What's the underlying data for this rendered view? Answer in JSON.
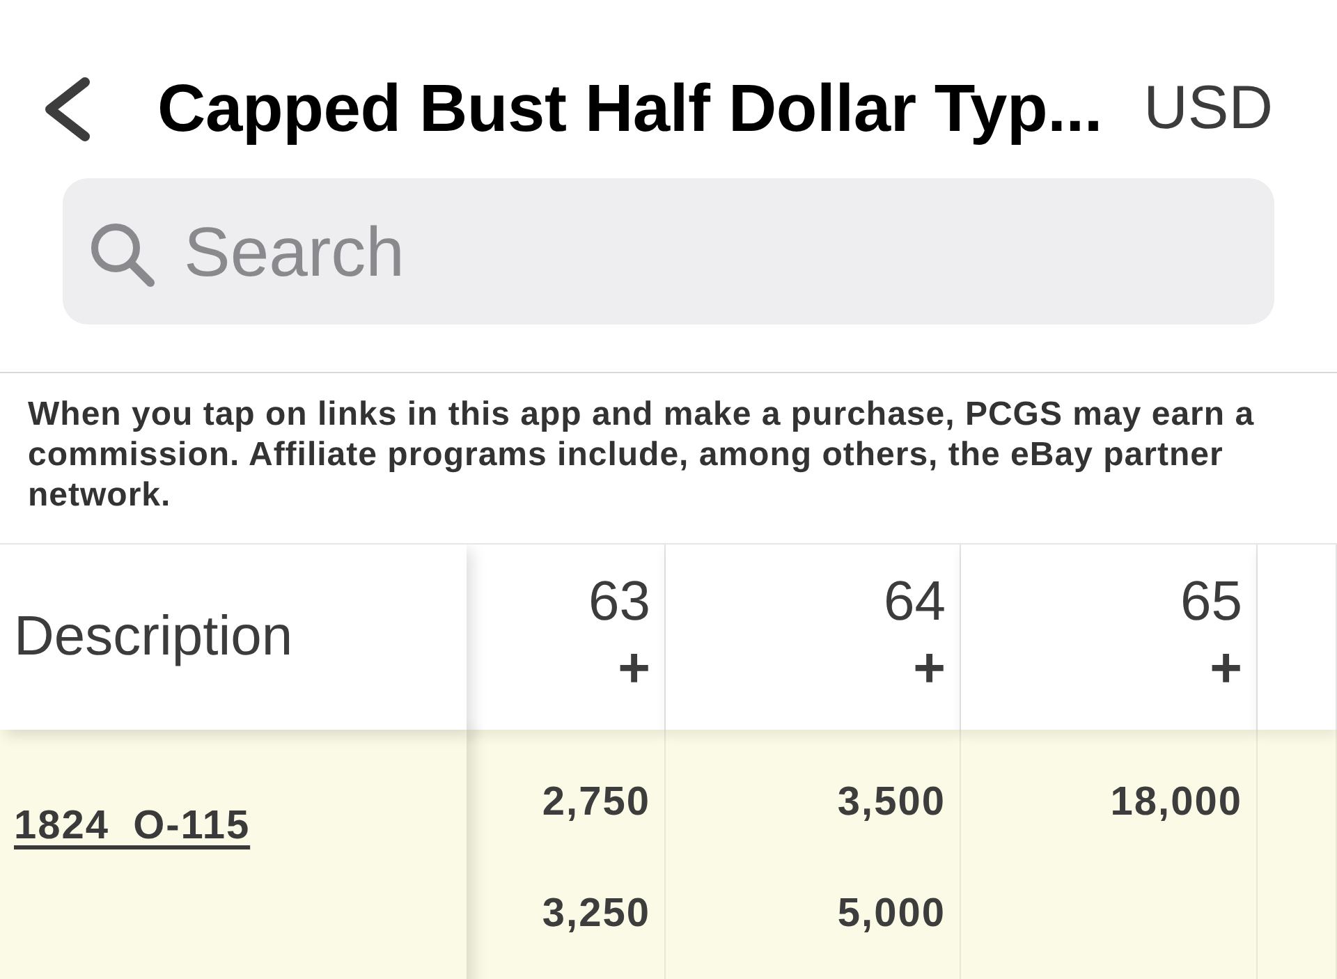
{
  "header": {
    "title": "Capped Bust Half Dollar Typ...",
    "currency": "USD"
  },
  "search": {
    "placeholder": "Search"
  },
  "disclaimer": "When you tap on links in this app and make a purchase, PCGS may earn a commission. Affiliate programs include, among others, the eBay partner network.",
  "table": {
    "description_header": "Description",
    "grade_columns": [
      {
        "grade": "63",
        "suffix": "+"
      },
      {
        "grade": "64",
        "suffix": "+"
      },
      {
        "grade": "65",
        "suffix": "+"
      }
    ],
    "rows": [
      {
        "description": "1824 O-115",
        "prices": [
          [
            "2,750",
            "3,250"
          ],
          [
            "3,500",
            "5,000"
          ],
          [
            "18,000"
          ]
        ]
      }
    ]
  }
}
